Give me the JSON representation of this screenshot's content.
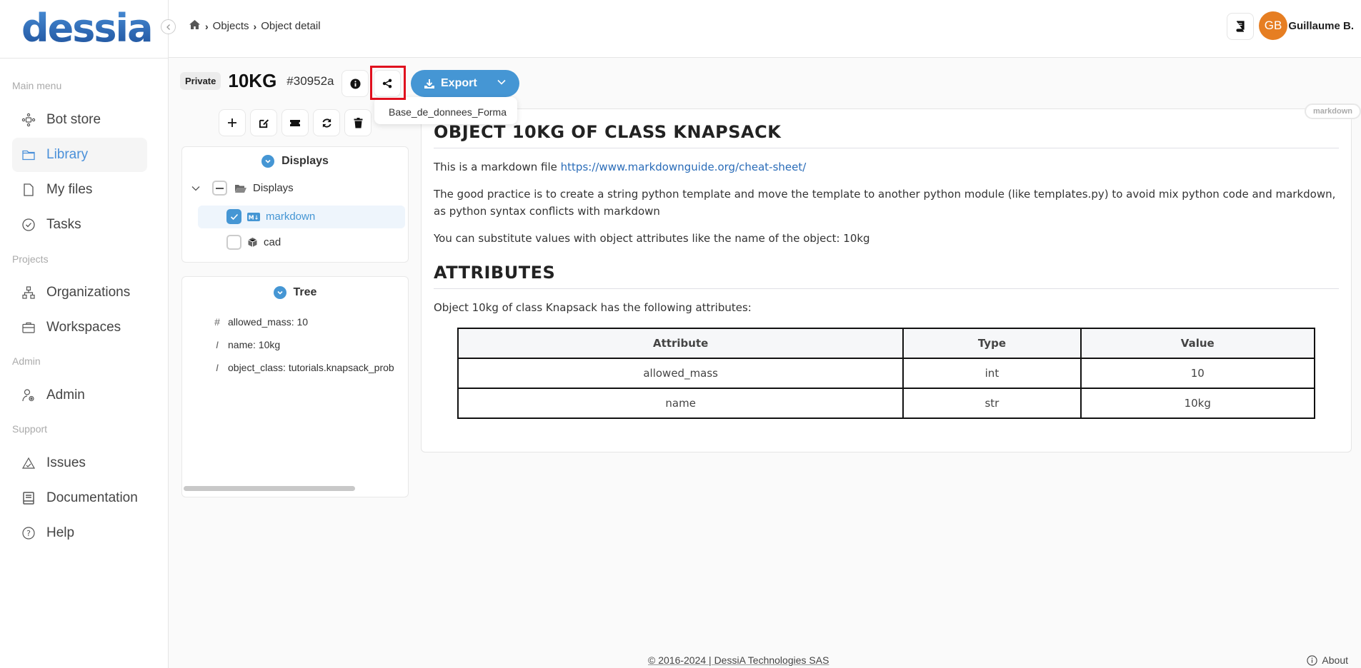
{
  "app": {
    "logo_text": "dessia"
  },
  "header": {
    "breadcrumb": [
      {
        "label": "Objects"
      },
      {
        "label": "Object detail"
      }
    ],
    "user": {
      "initials": "GB",
      "name": "Guillaume B.",
      "avatar_color": "#e67e22"
    }
  },
  "sidebar": {
    "sections": [
      {
        "title": "Main menu",
        "items": [
          {
            "label": "Bot store",
            "icon": "bot-store-icon"
          },
          {
            "label": "Library",
            "icon": "folder-icon",
            "active": true
          },
          {
            "label": "My files",
            "icon": "file-icon"
          },
          {
            "label": "Tasks",
            "icon": "check-circle-icon"
          }
        ]
      },
      {
        "title": "Projects",
        "items": [
          {
            "label": "Organizations",
            "icon": "org-chart-icon"
          },
          {
            "label": "Workspaces",
            "icon": "briefcase-icon"
          }
        ]
      },
      {
        "title": "Admin",
        "items": [
          {
            "label": "Admin",
            "icon": "user-gear-icon"
          }
        ]
      },
      {
        "title": "Support",
        "items": [
          {
            "label": "Issues",
            "icon": "warning-triangle-icon"
          },
          {
            "label": "Documentation",
            "icon": "document-icon"
          },
          {
            "label": "Help",
            "icon": "help-circle-icon"
          }
        ]
      }
    ]
  },
  "object": {
    "visibility": "Private",
    "title": "10KG",
    "id": "#30952a",
    "export_label": "Export",
    "share_dropdown_item": "Base_de_donnees_Forma"
  },
  "displays_panel": {
    "title": "Displays",
    "folder_label": "Displays",
    "items": [
      {
        "label": "markdown",
        "checked": true,
        "icon": "markdown-icon"
      },
      {
        "label": "cad",
        "checked": false,
        "icon": "cube-icon"
      }
    ]
  },
  "tree_panel": {
    "title": "Tree",
    "items": [
      {
        "glyph": "#",
        "label": "allowed_mass: 10"
      },
      {
        "glyph": "I",
        "label": "name: 10kg"
      },
      {
        "glyph": "I",
        "label": "object_class: tutorials.knapsack_prob"
      }
    ]
  },
  "markdown": {
    "tag": "markdown",
    "h1": "OBJECT 10KG OF CLASS KNAPSACK",
    "p1_text": "This is a markdown file ",
    "p1_link": "https://www.markdownguide.org/cheat-sheet/",
    "p2": "The good practice is to create a string python template and move the template to another python module (like templates.py) to avoid mix python code and markdown, as python syntax conflicts with markdown",
    "p3": "You can substitute values with object attributes like the name of the object: 10kg",
    "h2": "ATTRIBUTES",
    "p4": "Object 10kg of class Knapsack has the following attributes:",
    "table": {
      "headers": [
        "Attribute",
        "Type",
        "Value"
      ],
      "rows": [
        [
          "allowed_mass",
          "int",
          "10"
        ],
        [
          "name",
          "str",
          "10kg"
        ]
      ]
    }
  },
  "footer": {
    "copyright": "© 2016-2024 | DessiA Technologies SAS",
    "about": "About"
  }
}
